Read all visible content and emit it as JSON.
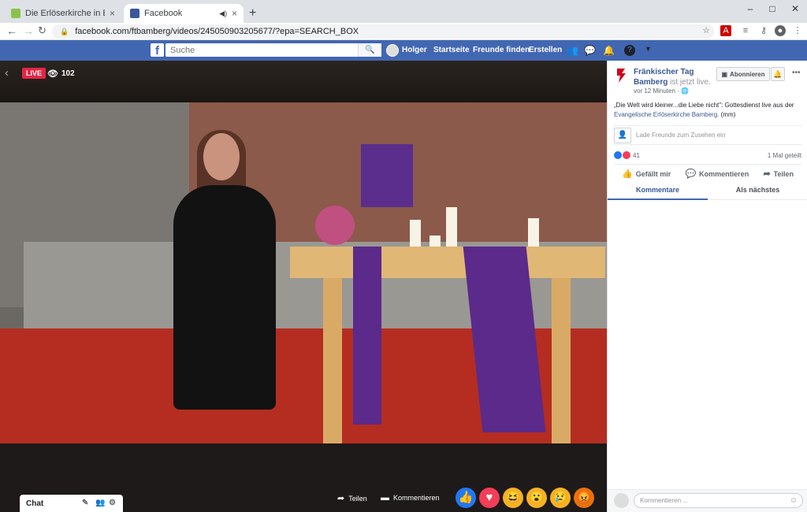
{
  "browser": {
    "tabs": [
      {
        "title": "Die Erlöserkirche in Bamberg ist ",
        "close": "×"
      },
      {
        "title": "Facebook",
        "close": "×"
      }
    ],
    "new_tab": "+",
    "window": {
      "minimize": "–",
      "maximize": "□",
      "close": "✕"
    },
    "url": "facebook.com/ftbamberg/videos/245050903205677/?epa=SEARCH_BOX"
  },
  "facebook": {
    "logo": "f",
    "search_placeholder": "Suche",
    "user": "Holger",
    "nav": [
      "Startseite",
      "Freunde finden",
      "Erstellen"
    ]
  },
  "video": {
    "live_badge": "LIVE",
    "viewers": "102",
    "actions": {
      "share": "Teilen",
      "comment": "Kommentieren"
    },
    "reaction_icons": [
      "like-icon",
      "love-icon",
      "haha-icon",
      "wow-icon",
      "sad-icon",
      "angry-icon"
    ]
  },
  "sidebar": {
    "page_name": "Fränkischer Tag Bamberg",
    "status": " ist jetzt live.",
    "time": "vor 12 Minuten · ",
    "subscribe": "Abonnieren",
    "description": "„Die Welt wird kleiner...die Liebe nicht\": Gottesdienst live aus der ",
    "description_link": "Evangelische Erlöserkirche Bamberg.",
    "description_tail": " (mm)",
    "invite": "Lade Freunde zum Zusehen ein",
    "reaction_count": "41",
    "shares": "1 Mal geteilt",
    "actions": {
      "like": "Gefällt mir",
      "comment": "Kommentieren",
      "share": "Teilen"
    },
    "tabs": {
      "comments": "Kommentare",
      "next": "Als nächstes"
    },
    "comment_placeholder": "Kommentieren ..."
  },
  "chat": {
    "label": "Chat"
  },
  "colors": {
    "facebook_blue": "#4267b2",
    "live_red": "#e42645",
    "link_blue": "#385898"
  }
}
